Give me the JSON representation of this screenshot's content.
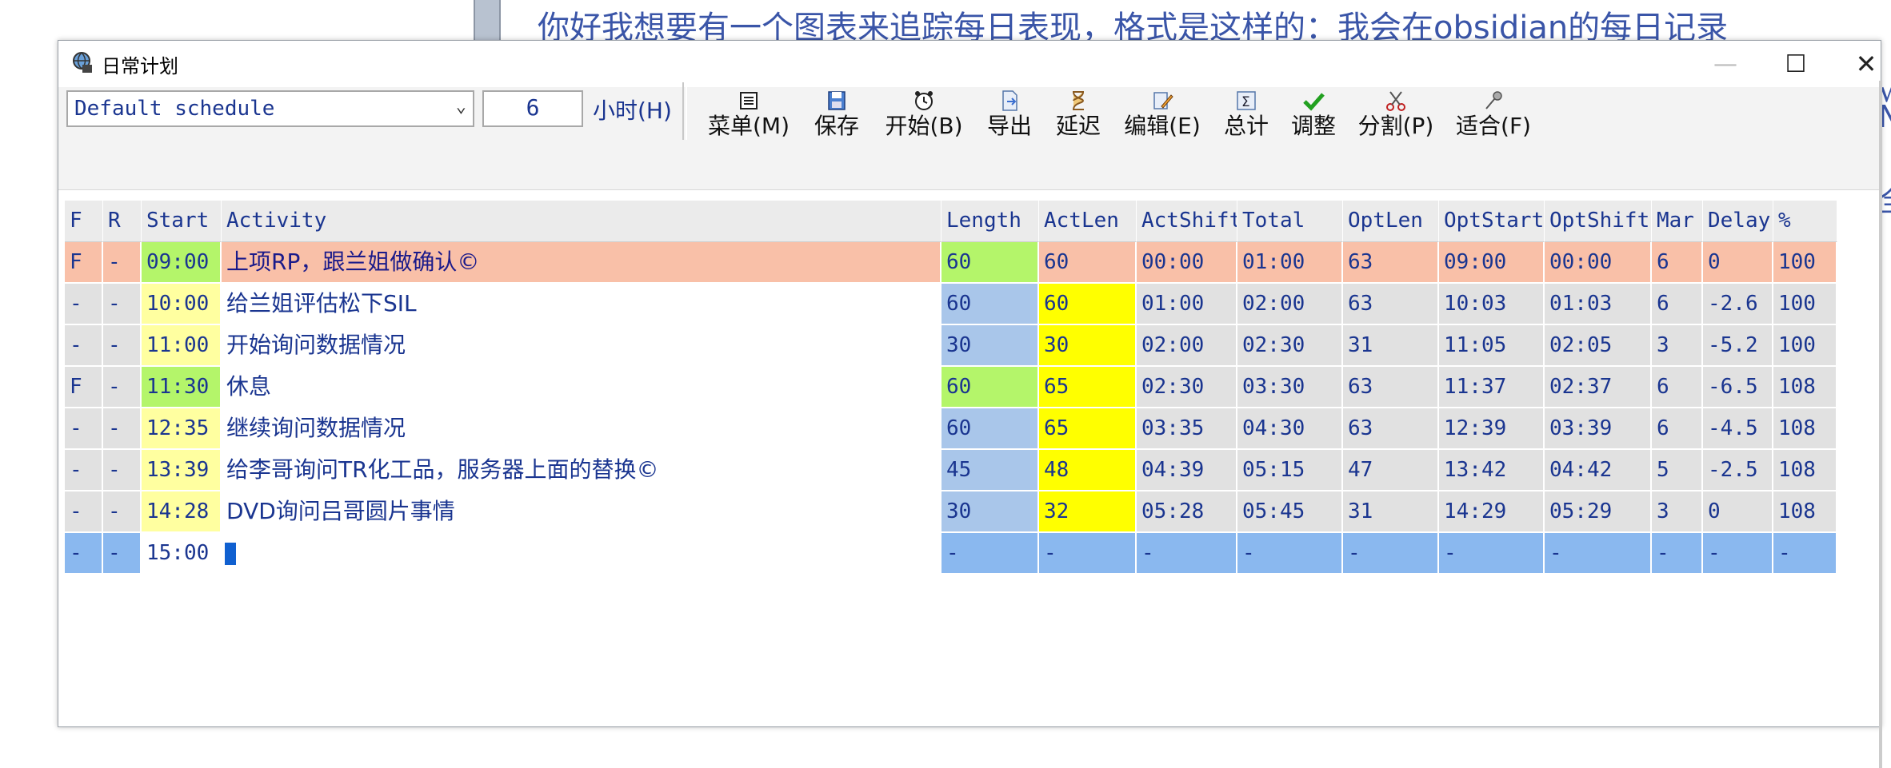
{
  "background_app": {
    "text": "你好我想要有一个图表来追踪每日表现，格式是这样的：我会在obsidian的每日记录",
    "right_glyphs": [
      "√",
      "N",
      "全"
    ]
  },
  "window": {
    "title": "日常计划",
    "controls": {
      "minimize": "—",
      "maximize": "☐",
      "close": "✕"
    }
  },
  "toolbar": {
    "schedule_value": "Default schedule",
    "hours_value": "6",
    "hours_label": "小时(H)",
    "buttons": [
      {
        "icon": "menu-icon",
        "label": "菜单(M)"
      },
      {
        "icon": "save-icon",
        "label": "保存"
      },
      {
        "icon": "alarm-clock-icon",
        "label": "开始(B)"
      },
      {
        "icon": "export-icon",
        "label": "导出"
      },
      {
        "icon": "hourglass-icon",
        "label": "延迟"
      },
      {
        "icon": "edit-icon",
        "label": "编辑(E)"
      },
      {
        "icon": "sum-icon",
        "label": "总计"
      },
      {
        "icon": "checkmark-icon",
        "label": "调整"
      },
      {
        "icon": "scissors-icon",
        "label": "分割(P)"
      },
      {
        "icon": "pin-icon",
        "label": "适合(F)"
      }
    ]
  },
  "grid": {
    "columns": [
      "F",
      "R",
      "Start",
      "Activity",
      "Length",
      "ActLen",
      "ActShift",
      "Total",
      "OptLen",
      "OptStart",
      "OptShift",
      "Mar",
      "Delay",
      "%"
    ],
    "rows": [
      [
        "F",
        "-",
        "09:00",
        "上项RP，跟兰姐做确认©",
        "60",
        "60",
        "00:00",
        "01:00",
        "63",
        "09:00",
        "00:00",
        "6",
        "0",
        "100"
      ],
      [
        "-",
        "-",
        "10:00",
        "给兰姐评估松下SIL",
        "60",
        "60",
        "01:00",
        "02:00",
        "63",
        "10:03",
        "01:03",
        "6",
        "-2.6",
        "100"
      ],
      [
        "-",
        "-",
        "11:00",
        "开始询问数据情况",
        "30",
        "30",
        "02:00",
        "02:30",
        "31",
        "11:05",
        "02:05",
        "3",
        "-5.2",
        "100"
      ],
      [
        "F",
        "-",
        "11:30",
        "休息",
        "60",
        "65",
        "02:30",
        "03:30",
        "63",
        "11:37",
        "02:37",
        "6",
        "-6.5",
        "108"
      ],
      [
        "-",
        "-",
        "12:35",
        "继续询问数据情况",
        "60",
        "65",
        "03:35",
        "04:30",
        "63",
        "12:39",
        "03:39",
        "6",
        "-4.5",
        "108"
      ],
      [
        "-",
        "-",
        "13:39",
        "给李哥询问TR化工品，服务器上面的替换©",
        "45",
        "48",
        "04:39",
        "05:15",
        "47",
        "13:42",
        "04:42",
        "5",
        "-2.5",
        "108"
      ],
      [
        "-",
        "-",
        "14:28",
        "DVD询问吕哥圆片事情",
        "30",
        "32",
        "05:28",
        "05:45",
        "31",
        "14:29",
        "05:29",
        "3",
        "0",
        "108"
      ],
      [
        "-",
        "-",
        "15:00",
        "",
        "-",
        "-",
        "-",
        "-",
        "-",
        "-",
        "-",
        "-",
        "-",
        "-"
      ]
    ]
  },
  "colors": {
    "row_fixed_salmon": "#f9c0a8",
    "gray_cell": "#e1e1e1",
    "length_blue": "#a9c6ea",
    "length_green": "#b4f56a",
    "start_yellow": "#ffffa0",
    "start_green": "#b4f56a",
    "actlen_yellow": "#ffff00",
    "new_row_blue": "#8ab8ef",
    "text_blue": "#1a3590"
  }
}
